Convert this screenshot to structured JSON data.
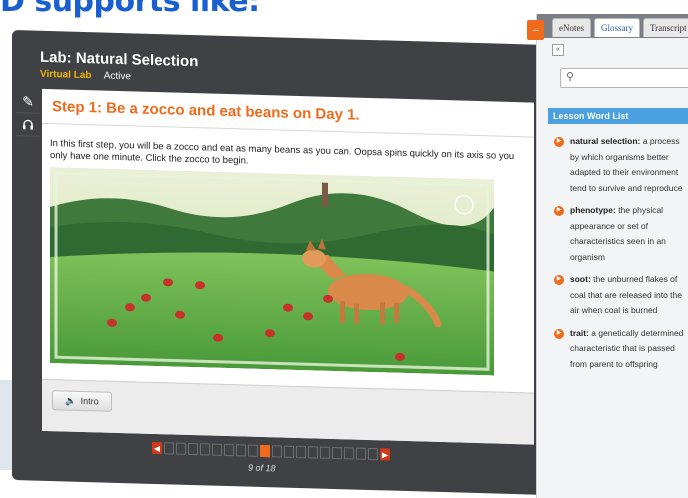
{
  "headline": "D supports like:",
  "lab": {
    "title": "Lab: Natural Selection",
    "subtitle": "Virtual Lab",
    "status": "Active"
  },
  "step": {
    "title": "Step 1: Be a zocco and eat beans on Day 1.",
    "description": "In this first step, you will be a zocco and eat as many beans as you can. Oopsa spins quickly on its axis so you only have one minute. Click the zocco to begin."
  },
  "intro_button": "Intro",
  "pager": {
    "count": "9 of 18",
    "total": 18,
    "current": 9
  },
  "sidebar": {
    "tabs": [
      "eNotes",
      "Glossary",
      "Transcript"
    ],
    "active_tab": "Glossary",
    "search_placeholder": "",
    "word_list_title": "Lesson Word List",
    "words": [
      {
        "term": "natural selection:",
        "definition": "a process by which organisms better adapted to their environment tend to survive and reproduce"
      },
      {
        "term": "phenotype:",
        "definition": "the physical appearance or set of characteristics seen in an organism"
      },
      {
        "term": "soot:",
        "definition": "the unburned flakes of coal that are released into the air when coal is burned"
      },
      {
        "term": "trait:",
        "definition": "a genetically determined characteristic that is passed from parent to offspring"
      }
    ]
  },
  "colors": {
    "accent": "#ef6a1b",
    "link": "#2d5fa8",
    "brand_blue": "#1a5fd0",
    "header_blue": "#4aa0e0"
  },
  "icons": [
    "pencil-icon",
    "headphones-icon",
    "speaker-icon",
    "minimize-icon",
    "collapse-icon",
    "search-icon",
    "arrow-left-icon",
    "arrow-right-icon"
  ]
}
